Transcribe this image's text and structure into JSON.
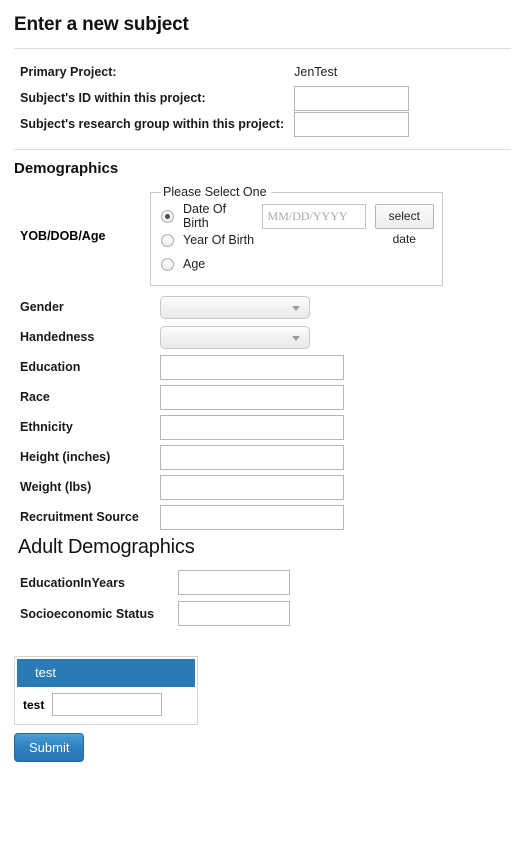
{
  "page": {
    "title": "Enter a new subject"
  },
  "project_section": {
    "rows": [
      {
        "label": "Primary Project:",
        "value": "JenTest",
        "type": "static"
      },
      {
        "label": "Subject's ID within this project:",
        "value": "",
        "type": "input"
      },
      {
        "label": "Subject's research group within this project:",
        "value": "",
        "type": "input"
      }
    ]
  },
  "demographics": {
    "heading": "Demographics",
    "dob": {
      "label": "YOB/DOB/Age",
      "legend": "Please Select One",
      "options": [
        {
          "label": "Date Of Birth",
          "selected": true
        },
        {
          "label": "Year Of Birth",
          "selected": false
        },
        {
          "label": "Age",
          "selected": false
        }
      ],
      "date_value": "",
      "date_placeholder": "MM/DD/YYYY",
      "select_date_label": "select date"
    },
    "fields": [
      {
        "label": "Gender",
        "type": "select",
        "value": ""
      },
      {
        "label": "Handedness",
        "type": "select",
        "value": ""
      },
      {
        "label": "Education",
        "type": "input",
        "value": ""
      },
      {
        "label": "Race",
        "type": "input",
        "value": ""
      },
      {
        "label": "Ethnicity",
        "type": "input",
        "value": ""
      },
      {
        "label": "Height (inches)",
        "type": "input",
        "value": ""
      },
      {
        "label": "Weight (lbs)",
        "type": "input",
        "value": ""
      },
      {
        "label": "Recruitment Source",
        "type": "input",
        "value": ""
      }
    ]
  },
  "adult_demographics": {
    "heading": "Adult Demographics",
    "fields": [
      {
        "label": "EducationInYears",
        "value": ""
      },
      {
        "label": "Socioeconomic Status",
        "value": ""
      }
    ]
  },
  "test_panel": {
    "header": "test",
    "field_label": "test",
    "field_value": ""
  },
  "submit": {
    "label": "Submit"
  },
  "colors": {
    "panel_header_blue": "#2a7ab5",
    "submit_blue": "#2f80be",
    "rule_gray": "#dddddd",
    "input_border": "#b6b6b6"
  }
}
